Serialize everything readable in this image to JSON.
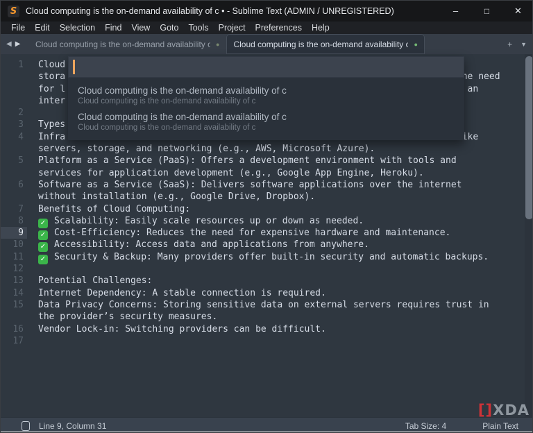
{
  "window": {
    "title": "Cloud computing is the on-demand availability of c • - Sublime Text (ADMIN / UNREGISTERED)",
    "icons": {
      "app_logo": "S",
      "minimize": "–",
      "maximize": "□",
      "close": "✕"
    }
  },
  "menu": {
    "items": [
      "File",
      "Edit",
      "Selection",
      "Find",
      "View",
      "Goto",
      "Tools",
      "Project",
      "Preferences",
      "Help"
    ]
  },
  "tab_bar": {
    "icons": {
      "prev": "◀",
      "next": "▶",
      "new_tab": "+",
      "overflow": "▼",
      "modified_dot": "●"
    },
    "tabs": [
      {
        "label": "Cloud computing is the on-demand availability of c",
        "active": false
      },
      {
        "label": "Cloud computing is the on-demand availability of c",
        "active": true
      }
    ]
  },
  "quick_panel": {
    "input_value": "",
    "caret_color": "#eda55d",
    "items": [
      {
        "title": "Cloud computing is the on-demand availability of c",
        "subtitle": "Cloud computing is the on-demand availability of c"
      },
      {
        "title": "Cloud computing is the on-demand availability of c",
        "subtitle": "Cloud computing is the on-demand availability of c"
      }
    ]
  },
  "editor": {
    "check_glyph": "✓",
    "check_color": "#3bb54a",
    "rows": [
      {
        "n": "1",
        "t": "Cloud"
      },
      {
        "n": "",
        "t": "stora",
        "t2": "ne need",
        "col2": 78
      },
      {
        "n": "",
        "t": "for l",
        "t2": "th an",
        "col2": 76
      },
      {
        "n": "",
        "t": "inter"
      },
      {
        "n": "2",
        "t": ""
      },
      {
        "n": "3",
        "t": "Types"
      },
      {
        "n": "4",
        "t": "Infra",
        "t2": "like",
        "col2": 77
      },
      {
        "n": "",
        "t": "servers, storage, and networking (e.g., AWS, Microsoft Azure)."
      },
      {
        "n": "5",
        "t": "Platform as a Service (PaaS): Offers a development environment with tools and"
      },
      {
        "n": "",
        "t": "services for application development (e.g., Google App Engine, Heroku)."
      },
      {
        "n": "6",
        "t": "Software as a Service (SaaS): Delivers software applications over the internet"
      },
      {
        "n": "",
        "t": "without installation (e.g., Google Drive, Dropbox)."
      },
      {
        "n": "7",
        "t": "Benefits of Cloud Computing:"
      },
      {
        "n": "8",
        "check": true,
        "t": "Scalability: Easily scale resources up or down as needed."
      },
      {
        "n": "9",
        "check": true,
        "current": true,
        "t": "Cost-Efficiency: Reduces the need for expensive hardware and maintenance."
      },
      {
        "n": "10",
        "check": true,
        "t": "Accessibility: Access data and applications from anywhere."
      },
      {
        "n": "11",
        "check": true,
        "t": "Security & Backup: Many providers offer built-in security and automatic backups."
      },
      {
        "n": "12",
        "t": ""
      },
      {
        "n": "13",
        "t": "Potential Challenges:"
      },
      {
        "n": "14",
        "t": "Internet Dependency: A stable connection is required."
      },
      {
        "n": "15",
        "t": "Data Privacy Concerns: Storing sensitive data on external servers requires trust in"
      },
      {
        "n": "",
        "t": "the provider’s security measures."
      },
      {
        "n": "16",
        "t": "Vendor Lock-in: Switching providers can be difficult."
      },
      {
        "n": "17",
        "t": ""
      }
    ]
  },
  "status_bar": {
    "line_col": "Line 9, Column 31",
    "tab_size": "Tab Size: 4",
    "syntax": "Plain Text"
  },
  "watermark": {
    "bracket": "[]",
    "text": "XDA"
  }
}
